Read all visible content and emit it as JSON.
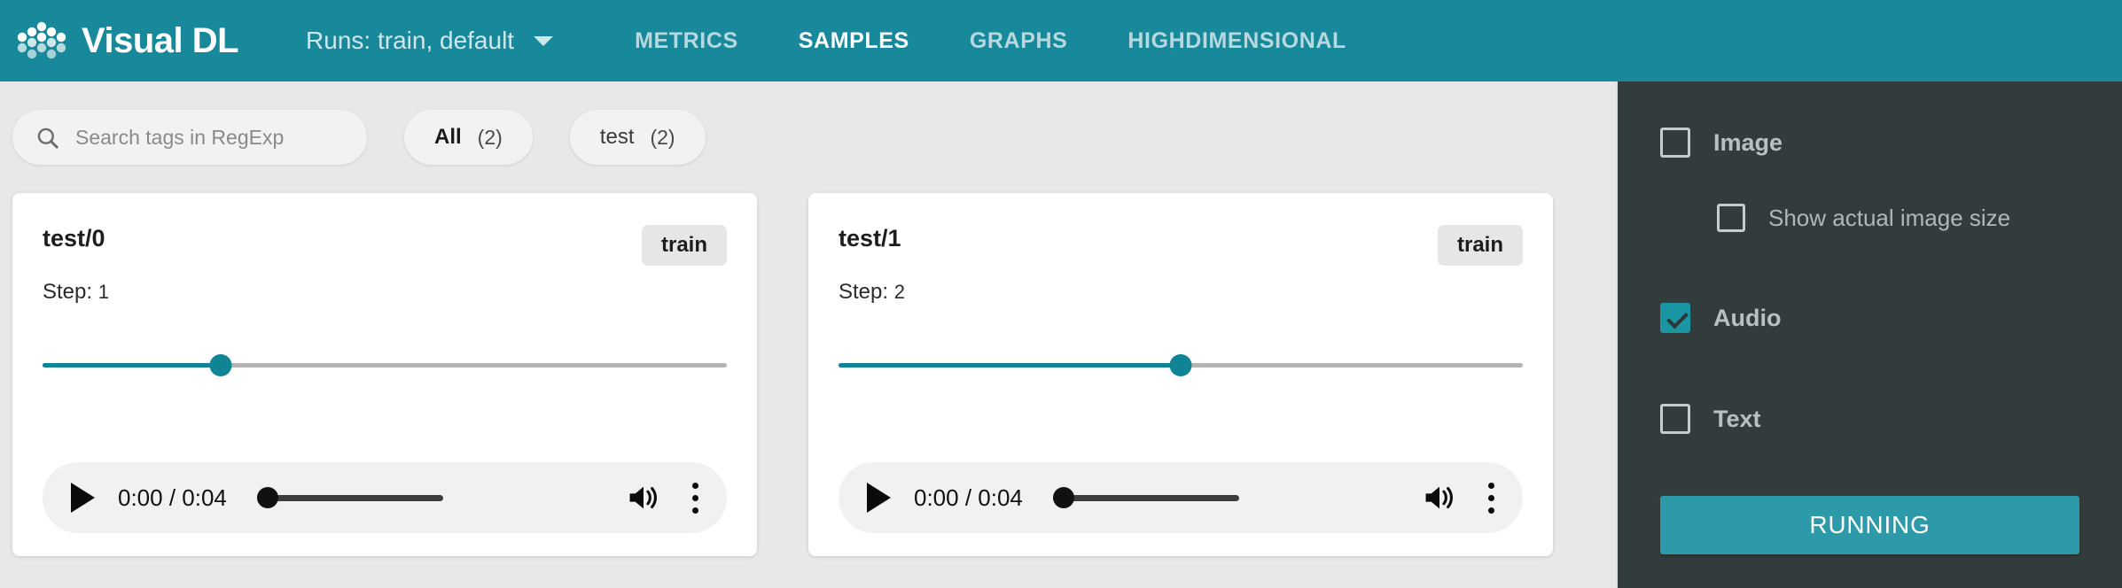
{
  "header": {
    "brand": "Visual DL",
    "logo_icon": "visualdl-dots-logo",
    "runs_label": "Runs: train, default",
    "caret_icon": "chevron-down-icon",
    "nav": [
      {
        "label": "METRICS",
        "active": false
      },
      {
        "label": "SAMPLES",
        "active": true
      },
      {
        "label": "GRAPHS",
        "active": false
      },
      {
        "label": "HIGHDIMENSIONAL",
        "active": false
      }
    ],
    "accent_color": "#18899b"
  },
  "toolbar": {
    "search_icon": "search-icon",
    "search_placeholder": "Search tags in RegExp",
    "search_value": "",
    "chips": [
      {
        "label": "All",
        "count": "(2)",
        "active": true
      },
      {
        "label": "test",
        "count": "(2)",
        "active": false
      }
    ]
  },
  "cards": [
    {
      "title": "test/0",
      "run_badge": "train",
      "step_label": "Step:",
      "step_value": "1",
      "step_slider_percent": 26,
      "player": {
        "play_icon": "play-icon",
        "time": "0:00 / 0:04",
        "volume_percent": 0,
        "volume_icon": "volume-up-icon",
        "menu_icon": "kebab-menu-icon"
      }
    },
    {
      "title": "test/1",
      "run_badge": "train",
      "step_label": "Step:",
      "step_value": "2",
      "step_slider_percent": 50,
      "player": {
        "play_icon": "play-icon",
        "time": "0:00 / 0:04",
        "volume_percent": 0,
        "volume_icon": "volume-up-icon",
        "menu_icon": "kebab-menu-icon"
      }
    }
  ],
  "sidebar": {
    "background_color": "#333c3d",
    "options": [
      {
        "label": "Image",
        "checked": false
      },
      {
        "label": "Show actual image size",
        "checked": false
      },
      {
        "label": "Audio",
        "checked": true
      },
      {
        "label": "Text",
        "checked": false
      }
    ],
    "status_button": "RUNNING",
    "status_color": "#2c9aa8"
  }
}
